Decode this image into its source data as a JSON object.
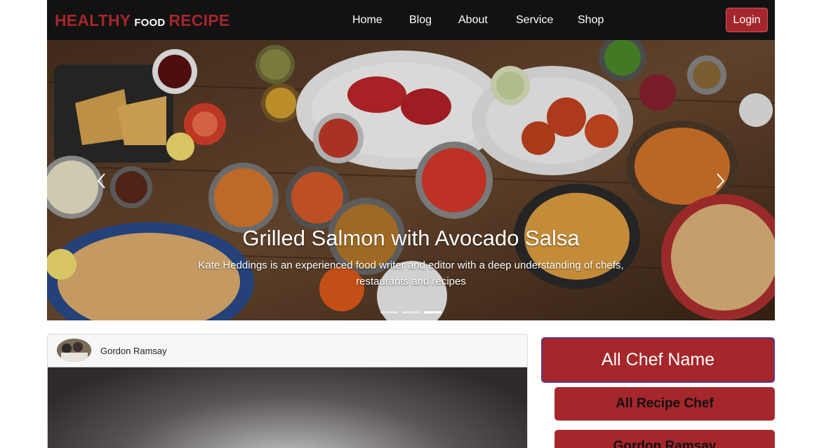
{
  "brand": {
    "part1": "HEALTHY",
    "part2": "FOOD",
    "part3": "RECIPE"
  },
  "nav": [
    {
      "label": "Home"
    },
    {
      "label": "Blog"
    },
    {
      "label": "About"
    },
    {
      "label": "Service"
    },
    {
      "label": "Shop"
    }
  ],
  "login_label": "Login",
  "carousel": {
    "title": "Grilled Salmon with Avocado Salsa",
    "description": "Kate Heddings is an experienced food writer and editor with a deep understanding of chefs, restaurants and recipes",
    "slide_count": 3,
    "active_slide": 3
  },
  "card": {
    "chef": "Gordon Ramsay"
  },
  "sidebar": {
    "heading": "All Chef Name",
    "buttons": [
      {
        "label": "All Recipe Chef"
      },
      {
        "label": "Gordon Ramsay"
      }
    ]
  },
  "colors": {
    "accent": "#a5262b",
    "nav_bg": "#121212",
    "border_purple": "#5a3a8a"
  }
}
